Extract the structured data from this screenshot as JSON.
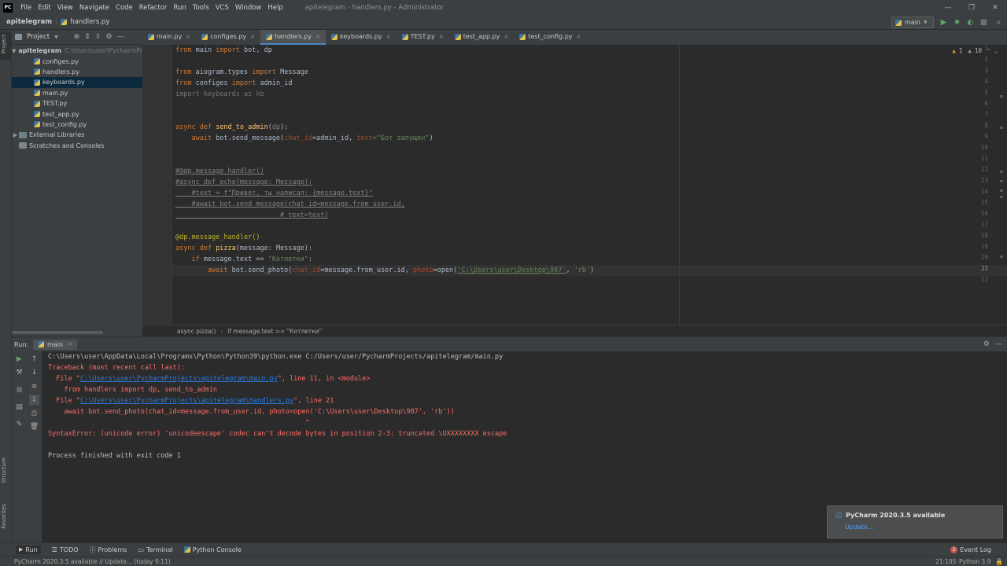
{
  "menubar": {
    "logo": "PC",
    "items": [
      "File",
      "Edit",
      "View",
      "Navigate",
      "Code",
      "Refactor",
      "Run",
      "Tools",
      "VCS",
      "Window",
      "Help"
    ],
    "title": "apitelegram - handlers.py - Administrator"
  },
  "navbar": {
    "project": "apitelegram",
    "file": "handlers.py",
    "run_config": "main"
  },
  "project_panel": {
    "header": "Project",
    "root": "apitelegram",
    "root_path": "C:\\Users\\user\\PycharmPr",
    "files": [
      "configes.py",
      "handlers.py",
      "keyboards.py",
      "main.py",
      "TEST.py",
      "test_app.py",
      "test_config.py"
    ],
    "selected": "keyboards.py",
    "external": "External Libraries",
    "scratches": "Scratches and Consoles"
  },
  "tabs": [
    {
      "label": "main.py"
    },
    {
      "label": "configes.py"
    },
    {
      "label": "handlers.py"
    },
    {
      "label": "keyboards.py"
    },
    {
      "label": "TEST.py"
    },
    {
      "label": "test_app.py"
    },
    {
      "label": "test_config.py"
    }
  ],
  "active_tab": "handlers.py",
  "editor": {
    "line_numbers": [
      "1",
      "2",
      "3",
      "4",
      "5",
      "6",
      "7",
      "8",
      "9",
      "10",
      "11",
      "12",
      "13",
      "14",
      "15",
      "16",
      "17",
      "18",
      "19",
      "20",
      "21",
      "22"
    ],
    "current_line": "21",
    "inspection": {
      "warnings": "1",
      "weak_warnings": "10"
    }
  },
  "breadcrumbs_bottom": [
    "async pizza()",
    "if message.text == \"Котлетки\""
  ],
  "left_strip": {
    "project": "Project",
    "structure": "Structure",
    "favorites": "Favorites"
  },
  "run": {
    "label": "Run:",
    "tab": "main",
    "output": [
      "C:\\Users\\user\\AppData\\Local\\Programs\\Python\\Python39\\python.exe C:/Users/user/PycharmProjects/apitelegram/main.py",
      "Traceback (most recent call last):",
      "  File \"",
      "C:\\Users\\user\\PycharmProjects\\apitelegram\\main.py",
      "\", line 11, in <module>",
      "    from handlers import dp, send_to_admin",
      "  File \"",
      "C:\\Users\\user\\PycharmProjects\\apitelegram\\handlers.py",
      "\", line 21",
      "    await bot.send_photo(chat_id=message.from_user.id, photo=open('C:\\Users\\user\\Desktop\\987', 'rb'))",
      "                                                                ^",
      "SyntaxError: (unicode error) 'unicodeescape' codec can't decode bytes in position 2-3: truncated \\UXXXXXXXX escape",
      "Process finished with exit code 1"
    ]
  },
  "notification": {
    "title": "PyCharm 2020.3.5 available",
    "link": "Update..."
  },
  "bottom_tools": [
    "Run",
    "TODO",
    "Problems",
    "Terminal",
    "Python Console"
  ],
  "event_log": "Event Log",
  "event_log_count": "2",
  "status": {
    "message": "PyCharm 2020.3.5 available // Update... (today 9:11)",
    "position": "21:105",
    "interpreter": "Python 3.9"
  }
}
